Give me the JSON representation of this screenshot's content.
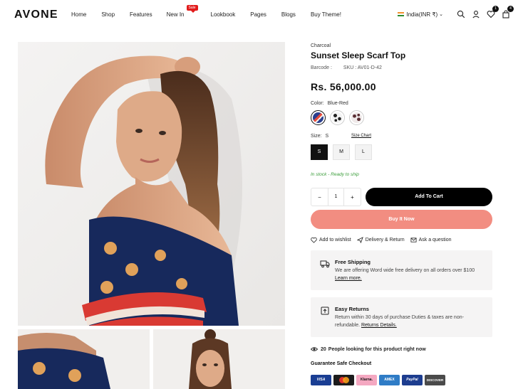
{
  "brand": {
    "logo": "AVONE"
  },
  "nav": {
    "items": [
      "Home",
      "Shop",
      "Features",
      "New In",
      "Lookbook",
      "Pages",
      "Blogs",
      "Buy Theme!"
    ],
    "sale_badge": "Sale"
  },
  "header": {
    "currency": "India(INR ₹)",
    "wishlist_count": "1",
    "cart_count": "4"
  },
  "product": {
    "vendor": "Charcoal",
    "title": "Sunset Sleep Scarf Top",
    "barcode_label": "Barcode :",
    "sku": "SKU : AV01-D-42",
    "price": "Rs. 56,000.00",
    "color_label": "Color:",
    "color_value": "Blue-Red",
    "swatches": [
      {
        "name": "Blue-Red",
        "color": "#2a3f8f"
      },
      {
        "name": "Black-White",
        "color": "#222222"
      },
      {
        "name": "Brown-White",
        "color": "#5a2f34"
      }
    ],
    "size_label": "Size:",
    "size_value": "S",
    "size_chart": "Size Chart",
    "sizes": [
      "S",
      "M",
      "L"
    ],
    "stock": "In stock - Ready to ship",
    "qty_minus": "−",
    "qty_value": "1",
    "qty_plus": "+",
    "add_to_cart": "Add To Cart",
    "buy_now": "Buy It Now"
  },
  "actions": {
    "wishlist": "Add to wishlist",
    "delivery": "Delivery & Return",
    "question": "Ask a question"
  },
  "shipping": {
    "title": "Free Shipping",
    "text": "We are offering Word wide free delivery on all orders over $100",
    "link": "Learn more."
  },
  "returns": {
    "title": "Easy Returns",
    "text": "Return within 30 days of purchase Duties & taxes are non-refundable.",
    "link": "Returns Details."
  },
  "looking": {
    "count_text": "20",
    "text": "People looking for this product right now"
  },
  "checkout": {
    "title": "Guarantee Safe Checkout",
    "payments": [
      {
        "name": "VISA",
        "color": "#1a3e93"
      },
      {
        "name": "mastercard",
        "color": "#e0322d"
      },
      {
        "name": "Klarna.",
        "color": "#f4a8c1"
      },
      {
        "name": "AMEX",
        "color": "#2f7cc6"
      },
      {
        "name": "PayPal",
        "color": "#1d3d8f"
      },
      {
        "name": "DISCOVER",
        "color": "#4a4a4a"
      }
    ]
  }
}
